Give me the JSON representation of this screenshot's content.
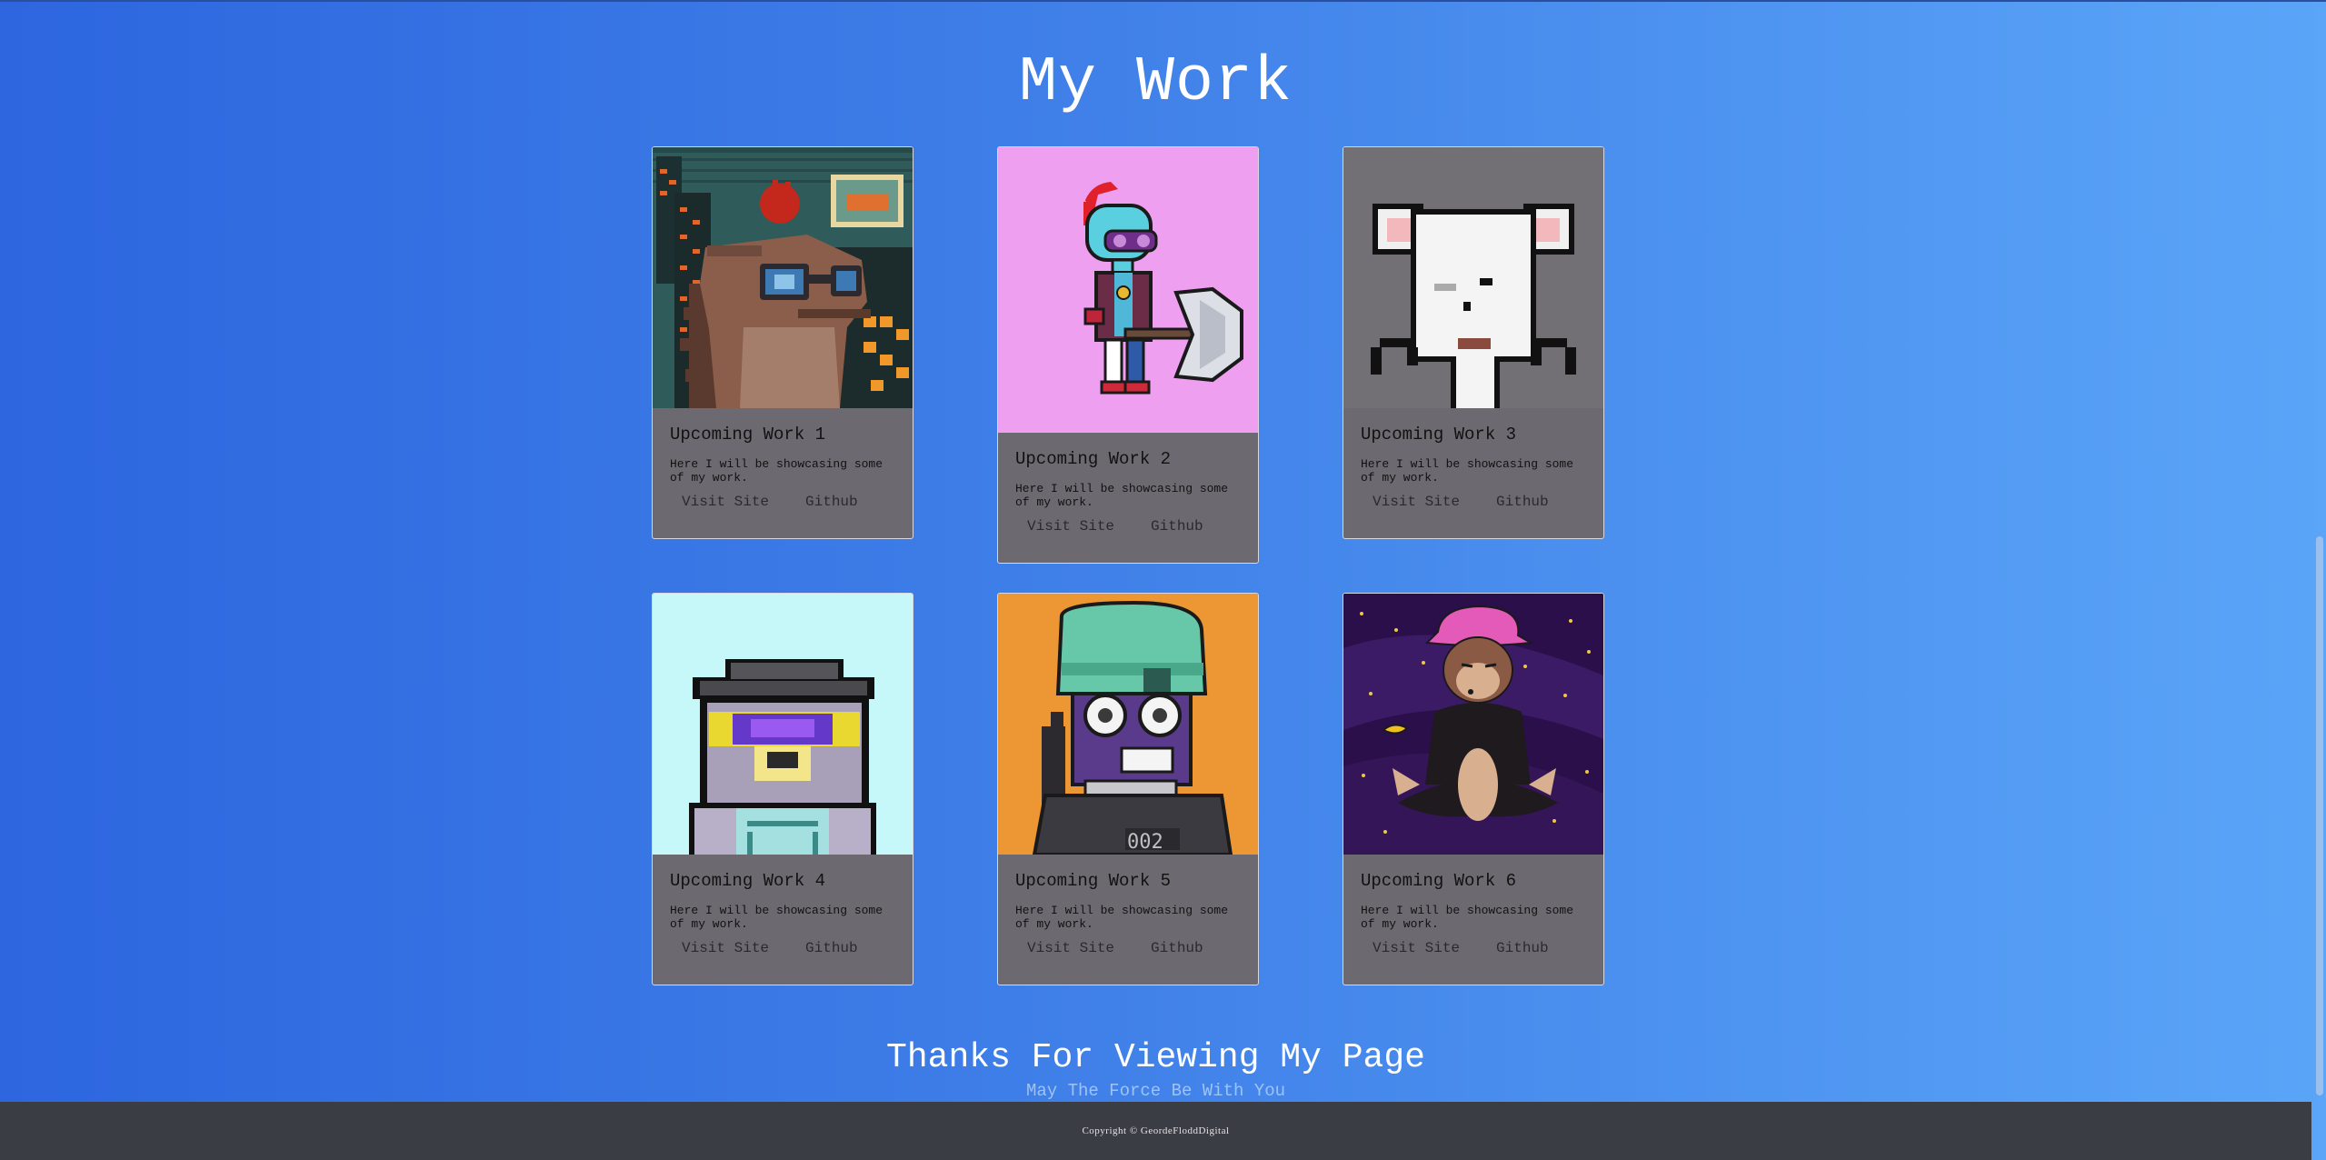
{
  "page": {
    "title": "My Work",
    "thanks": "Thanks For Viewing My Page",
    "subtitle": "May The Force Be With You",
    "copyright": "Copyright © GeordeFloddDigital"
  },
  "colors": {
    "background_start": "#2d66df",
    "background_end": "#5aa5f8",
    "card_bg": "#6c6a70",
    "footer_bg": "#3b3d44"
  },
  "cards": [
    {
      "title": "Upcoming Work 1",
      "description": "Here I will be showcasing some of my work.",
      "visit_label": "Visit Site",
      "github_label": "Github",
      "art": "pixel-dinosaur-city-art"
    },
    {
      "title": "Upcoming Work 2",
      "description": "Here I will be showcasing some of my work.",
      "visit_label": "Visit Site",
      "github_label": "Github",
      "art": "pixel-robot-axe-art"
    },
    {
      "title": "Upcoming Work 3",
      "description": "Here I will be showcasing some of my work.",
      "visit_label": "Visit Site",
      "github_label": "Github",
      "art": "pixel-mouse-art"
    },
    {
      "title": "Upcoming Work 4",
      "description": "Here I will be showcasing some of my work.",
      "visit_label": "Visit Site",
      "github_label": "Github",
      "art": "pixel-koala-art"
    },
    {
      "title": "Upcoming Work 5",
      "description": "Here I will be showcasing some of my work.",
      "visit_label": "Visit Site",
      "github_label": "Github",
      "art": "pixel-gorilla-beanie-art"
    },
    {
      "title": "Upcoming Work 6",
      "description": "Here I will be showcasing some of my work.",
      "visit_label": "Visit Site",
      "github_label": "Github",
      "art": "meditating-ape-space-art"
    }
  ]
}
